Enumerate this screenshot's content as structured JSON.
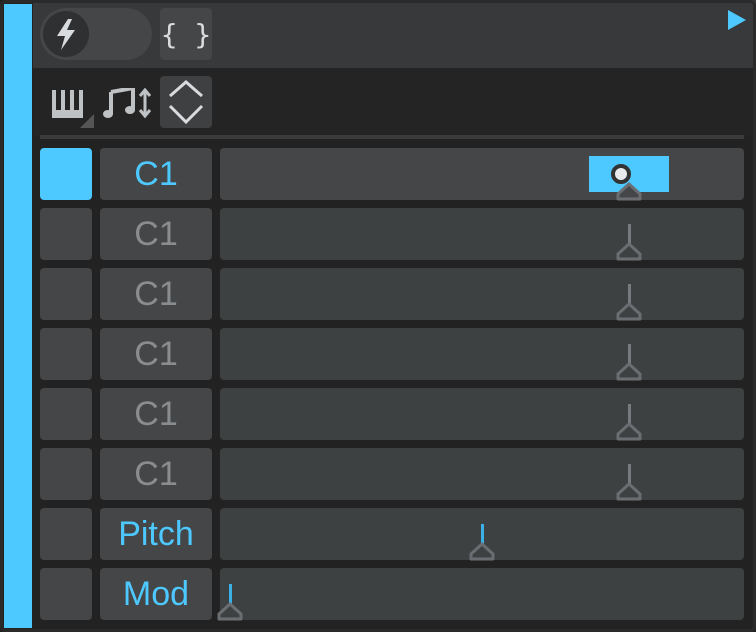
{
  "toolbar": {
    "braces_label": "{ }",
    "icons": [
      "lightning-icon",
      "piano-keys-icon",
      "note-transpose-icon",
      "up-down-chevron-icon",
      "play-icon"
    ]
  },
  "accent": "#4dc9ff",
  "rows": [
    {
      "label": "C1",
      "selected": true,
      "value": 0.78,
      "active_range": true
    },
    {
      "label": "C1",
      "selected": false,
      "value": 0.78
    },
    {
      "label": "C1",
      "selected": false,
      "value": 0.78
    },
    {
      "label": "C1",
      "selected": false,
      "value": 0.78
    },
    {
      "label": "C1",
      "selected": false,
      "value": 0.78
    },
    {
      "label": "C1",
      "selected": false,
      "value": 0.78
    },
    {
      "label": "Pitch",
      "selected": false,
      "value": 0.5,
      "blue": true
    },
    {
      "label": "Mod",
      "selected": false,
      "value": 0.02,
      "blue": true
    }
  ]
}
